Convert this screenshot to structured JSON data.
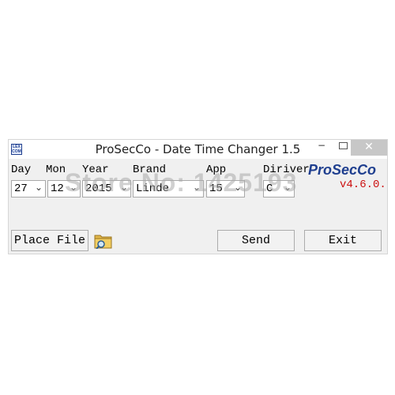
{
  "window": {
    "title": "ProSecCo - Date Time Changer 1.5",
    "icon_name": "lex-com-app-icon",
    "icon_text_line1": "LEX",
    "icon_text_line2": "COM",
    "controls": {
      "minimize": "−",
      "close": "✕"
    }
  },
  "fields": {
    "day": {
      "label": "Day",
      "value": "27"
    },
    "mon": {
      "label": "Mon",
      "value": "12"
    },
    "year": {
      "label": "Year",
      "value": "2015"
    },
    "brand": {
      "label": "Brand",
      "value": "Linde"
    },
    "app": {
      "label": "App",
      "value": "15"
    },
    "driver": {
      "label": "Diriver",
      "value": "C"
    }
  },
  "dropdown_arrow": "⌄",
  "branding": {
    "logo": "ProSecCo",
    "version": "v4.6.0.",
    "logo_color": "#1f3f8f",
    "version_color": "#cc1111"
  },
  "buttons": {
    "place_file": "Place File",
    "send": "Send",
    "exit": "Exit"
  },
  "watermark": "Store No: 1425193"
}
